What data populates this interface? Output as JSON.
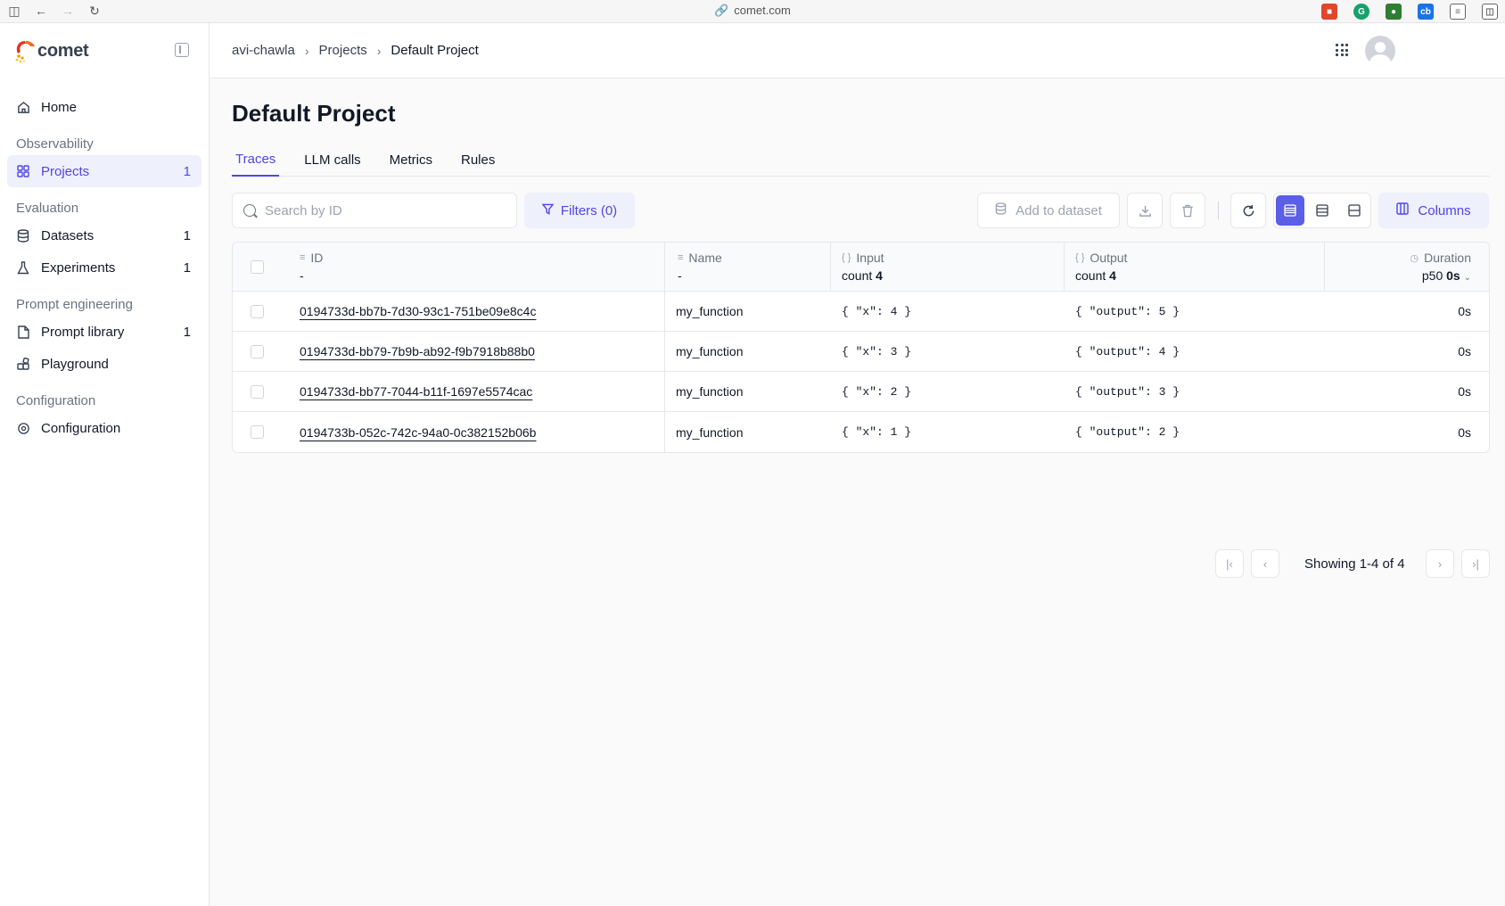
{
  "browser": {
    "url": "comet.com"
  },
  "app": {
    "logo_text": "comet"
  },
  "sidebar": {
    "home": {
      "label": "Home"
    },
    "sections": {
      "observability": "Observability",
      "evaluation": "Evaluation",
      "prompt_engineering": "Prompt engineering",
      "configuration": "Configuration"
    },
    "projects": {
      "label": "Projects",
      "count": "1"
    },
    "datasets": {
      "label": "Datasets",
      "count": "1"
    },
    "experiments": {
      "label": "Experiments",
      "count": "1"
    },
    "prompt_library": {
      "label": "Prompt library",
      "count": "1"
    },
    "playground": {
      "label": "Playground"
    },
    "configuration": {
      "label": "Configuration"
    }
  },
  "breadcrumb": {
    "workspace": "avi-chawla",
    "projects": "Projects",
    "current": "Default Project"
  },
  "page": {
    "title": "Default Project"
  },
  "tabs": [
    "Traces",
    "LLM calls",
    "Metrics",
    "Rules"
  ],
  "toolbar": {
    "search_placeholder": "Search by ID",
    "filters_label": "Filters (0)",
    "add_to_dataset_label": "Add to dataset",
    "columns_label": "Columns"
  },
  "table": {
    "headers": {
      "id": "ID",
      "id_sub": "-",
      "name": "Name",
      "name_sub": "-",
      "input": "Input",
      "input_sub_label": "count",
      "input_sub_value": "4",
      "output": "Output",
      "output_sub_label": "count",
      "output_sub_value": "4",
      "duration": "Duration",
      "duration_sub_label": "p50",
      "duration_sub_value": "0s"
    },
    "rows": [
      {
        "id": "0194733d-bb7b-7d30-93c1-751be09e8c4c",
        "name": "my_function",
        "input": "{ \"x\": 4 }",
        "output": "{ \"output\": 5 }",
        "duration": "0s"
      },
      {
        "id": "0194733d-bb79-7b9b-ab92-f9b7918b88b0",
        "name": "my_function",
        "input": "{ \"x\": 3 }",
        "output": "{ \"output\": 4 }",
        "duration": "0s"
      },
      {
        "id": "0194733d-bb77-7044-b11f-1697e5574cac",
        "name": "my_function",
        "input": "{ \"x\": 2 }",
        "output": "{ \"output\": 3 }",
        "duration": "0s"
      },
      {
        "id": "0194733b-052c-742c-94a0-0c382152b06b",
        "name": "my_function",
        "input": "{ \"x\": 1 }",
        "output": "{ \"output\": 2 }",
        "duration": "0s"
      }
    ]
  },
  "pagination": {
    "text": "Showing 1-4 of 4"
  },
  "colors": {
    "accent": "#4f46e5",
    "accent_bg": "#eef0fb"
  }
}
